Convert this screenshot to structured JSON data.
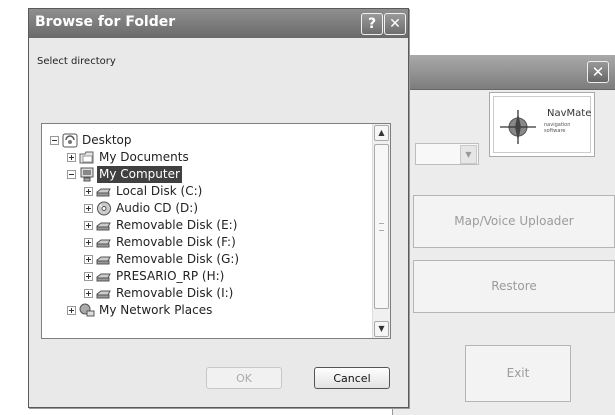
{
  "background_app": {
    "close_glyph": "✕",
    "logo_name": "NavMate",
    "logo_tagline": "navigation software",
    "uploader_label": "Map/Voice Uploader",
    "restore_label": "Restore",
    "exit_label": "Exit"
  },
  "dialog": {
    "title": "Browse for Folder",
    "help_glyph": "?",
    "close_glyph": "✕",
    "prompt": "Select directory",
    "ok_label": "OK",
    "cancel_label": "Cancel",
    "tree": [
      {
        "label": "Desktop",
        "icon": "desktop-icon",
        "expanded": true,
        "depth": 0
      },
      {
        "label": "My Documents",
        "icon": "folder-icon",
        "expanded": false,
        "depth": 1
      },
      {
        "label": "My Computer",
        "icon": "computer-icon",
        "expanded": true,
        "depth": 1,
        "selected": true
      },
      {
        "label": "Local Disk (C:)",
        "icon": "disk-icon",
        "expanded": false,
        "depth": 2
      },
      {
        "label": "Audio CD (D:)",
        "icon": "cd-icon",
        "expanded": false,
        "depth": 2
      },
      {
        "label": "Removable Disk (E:)",
        "icon": "disk-icon",
        "expanded": false,
        "depth": 2
      },
      {
        "label": "Removable Disk (F:)",
        "icon": "disk-icon",
        "expanded": false,
        "depth": 2
      },
      {
        "label": "Removable Disk (G:)",
        "icon": "disk-icon",
        "expanded": false,
        "depth": 2
      },
      {
        "label": "PRESARIO_RP (H:)",
        "icon": "disk-icon",
        "expanded": false,
        "depth": 2
      },
      {
        "label": "Removable Disk (I:)",
        "icon": "disk-icon",
        "expanded": false,
        "depth": 2
      },
      {
        "label": "My Network Places",
        "icon": "network-icon",
        "expanded": false,
        "depth": 1
      }
    ]
  },
  "colors": {
    "selection": "#404040",
    "titlebar": "#7a7a7a"
  }
}
